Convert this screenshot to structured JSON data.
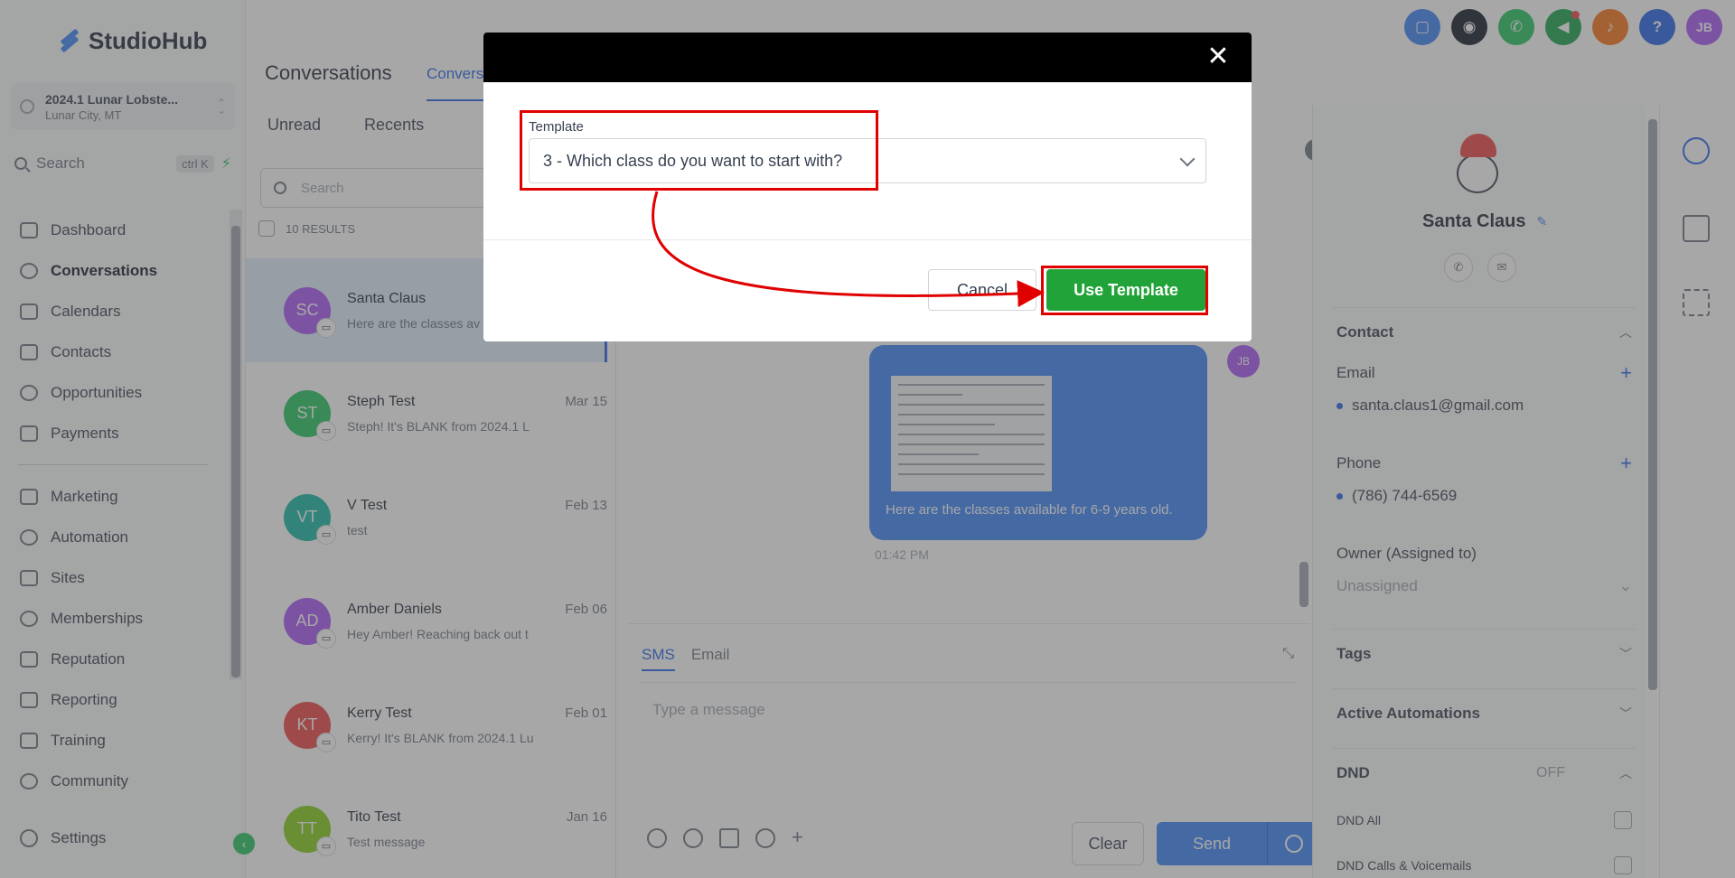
{
  "app": {
    "name": "StudioHub"
  },
  "location": {
    "name": "2024.1 Lunar Lobste...",
    "city": "Lunar City, MT"
  },
  "sidebar": {
    "search_label": "Search",
    "search_shortcut": "ctrl K",
    "items_top": [
      {
        "label": "Dashboard",
        "icon": "dashboard-icon"
      },
      {
        "label": "Conversations",
        "icon": "chat-icon",
        "active": true
      },
      {
        "label": "Calendars",
        "icon": "calendar-icon"
      },
      {
        "label": "Contacts",
        "icon": "contacts-icon"
      },
      {
        "label": "Opportunities",
        "icon": "opportunities-icon"
      },
      {
        "label": "Payments",
        "icon": "payments-icon"
      }
    ],
    "items_bottom": [
      {
        "label": "Marketing",
        "icon": "send-icon"
      },
      {
        "label": "Automation",
        "icon": "automation-icon"
      },
      {
        "label": "Sites",
        "icon": "sites-icon"
      },
      {
        "label": "Memberships",
        "icon": "memberships-icon"
      },
      {
        "label": "Reputation",
        "icon": "star-icon"
      },
      {
        "label": "Reporting",
        "icon": "chart-icon"
      },
      {
        "label": "Training",
        "icon": "book-icon"
      },
      {
        "label": "Community",
        "icon": "community-icon"
      }
    ],
    "settings_label": "Settings"
  },
  "header": {
    "title": "Conversations",
    "tab": "Convers",
    "top_icons": [
      {
        "name": "chat-widget-icon",
        "color": "#3b82f6",
        "glyph": "▢"
      },
      {
        "name": "bot-icon",
        "color": "#111827",
        "glyph": "◉"
      },
      {
        "name": "phone-icon",
        "color": "#22c55e",
        "glyph": "✆"
      },
      {
        "name": "megaphone-icon",
        "color": "#16a34a",
        "glyph": "◀"
      },
      {
        "name": "bell-icon",
        "color": "#f97316",
        "glyph": "♪"
      },
      {
        "name": "help-icon",
        "color": "#2563eb",
        "glyph": "?"
      },
      {
        "name": "user-avatar",
        "color": "#a855f7",
        "glyph": "JB"
      }
    ]
  },
  "list": {
    "tabs": [
      "Unread",
      "Recents"
    ],
    "search_placeholder": "Search",
    "results": "10 RESULTS",
    "conversations": [
      {
        "initials": "SC",
        "name": "Santa Claus",
        "date": "",
        "snippet": "Here are the classes av",
        "color": "#a855f7",
        "selected": true
      },
      {
        "initials": "ST",
        "name": "Steph Test",
        "date": "Mar 15",
        "snippet": "Steph! It's BLANK from 2024.1 L",
        "color": "#22c55e"
      },
      {
        "initials": "VT",
        "name": "V Test",
        "date": "Feb 13",
        "snippet": "test",
        "color": "#14b8a6"
      },
      {
        "initials": "AD",
        "name": "Amber Daniels",
        "date": "Feb 06",
        "snippet": "Hey Amber! Reaching back out t",
        "color": "#a855f7"
      },
      {
        "initials": "KT",
        "name": "Kerry Test",
        "date": "Feb 01",
        "snippet": "Kerry! It's BLANK from 2024.1 Lu",
        "color": "#ef4444"
      },
      {
        "initials": "TT",
        "name": "Tito Test",
        "date": "Jan 16",
        "snippet": "Test message",
        "color": "#84cc16"
      }
    ]
  },
  "message": {
    "avatar": "JB",
    "text": "Here are the classes available for 6-9 years old.",
    "time": "01:42 PM"
  },
  "composer": {
    "tabs": [
      "SMS",
      "Email"
    ],
    "placeholder": "Type a message",
    "clear_label": "Clear",
    "send_label": "Send"
  },
  "contact": {
    "name": "Santa Claus",
    "contact_title": "Contact",
    "email_label": "Email",
    "email": "santa.claus1@gmail.com",
    "phone_label": "Phone",
    "phone": "(786) 744-6569",
    "owner_label": "Owner (Assigned to)",
    "owner": "Unassigned",
    "tags_title": "Tags",
    "automations_title": "Active Automations",
    "dnd_title": "DND",
    "dnd_status": "OFF",
    "dnd_all": "DND All",
    "dnd_calls": "DND Calls & Voicemails"
  },
  "modal": {
    "template_label": "Template",
    "template_value": "3 - Which class do you want to start with?",
    "cancel_label": "Cancel",
    "use_label": "Use Template",
    "close_glyph": "✕"
  },
  "annotation_color": "#e00000"
}
